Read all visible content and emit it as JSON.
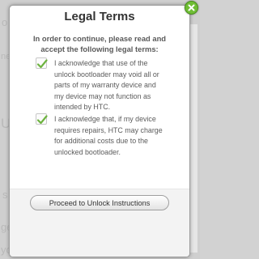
{
  "dialog": {
    "title": "Legal Terms",
    "intro": "In order to continue, please read and accept the following legal terms:",
    "items": [
      {
        "text": "I acknowledge that use of the unlock bootloader may void all or parts of my warranty device and my device may not function as intended by HTC.",
        "checked": true
      },
      {
        "text": "I acknowledge that, if my device requires repairs, HTC may charge for additional costs due to the unlocked bootloader.",
        "checked": true
      }
    ],
    "proceed_label": "Proceed to Unlock Instructions"
  },
  "background": {
    "fragments": [
      "o",
      "ne",
      "Ut",
      "s",
      "ge",
      "yc"
    ]
  },
  "colors": {
    "checkmark": "#6db33f",
    "close_button": "#6fbd35"
  }
}
